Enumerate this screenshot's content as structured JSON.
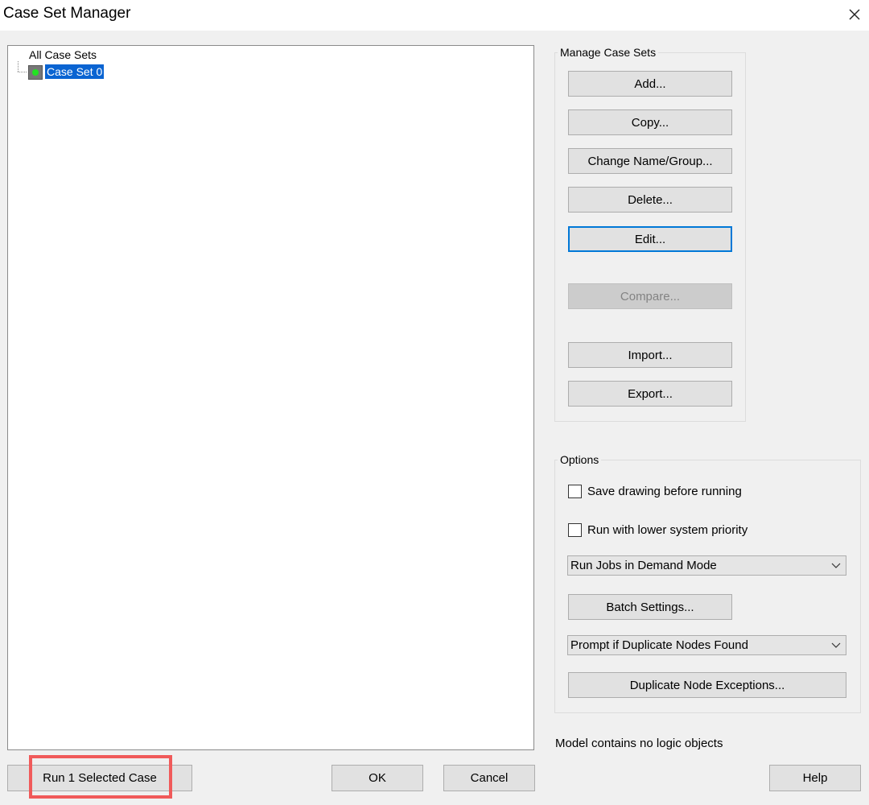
{
  "window": {
    "title": "Case Set Manager",
    "close_icon": "close-icon"
  },
  "tree": {
    "root_label": "All Case Sets",
    "items": [
      {
        "label": "Case Set 0",
        "status_color": "#22e222",
        "selected": true
      }
    ]
  },
  "manage": {
    "title": "Manage Case Sets",
    "buttons": {
      "add": "Add...",
      "copy": "Copy...",
      "change_name": "Change Name/Group...",
      "delete": "Delete...",
      "edit": "Edit...",
      "compare": "Compare...",
      "import": "Import...",
      "export": "Export..."
    }
  },
  "options": {
    "title": "Options",
    "save_drawing": {
      "label": "Save drawing before running",
      "checked": false
    },
    "lower_priority": {
      "label": "Run with lower system priority",
      "checked": false
    },
    "run_mode": {
      "selected": "Run Jobs in Demand Mode"
    },
    "batch_settings": "Batch Settings...",
    "duplicate_prompt": {
      "selected": "Prompt if Duplicate Nodes Found"
    },
    "duplicate_exceptions": "Duplicate Node Exceptions..."
  },
  "status_text": "Model contains no logic objects",
  "footer": {
    "run_selected": "Run 1 Selected Case",
    "ok": "OK",
    "cancel": "Cancel",
    "help": "Help"
  },
  "colors": {
    "selection": "#0a64d2",
    "highlight_frame": "#f05a5a",
    "focus": "#0078d7"
  }
}
